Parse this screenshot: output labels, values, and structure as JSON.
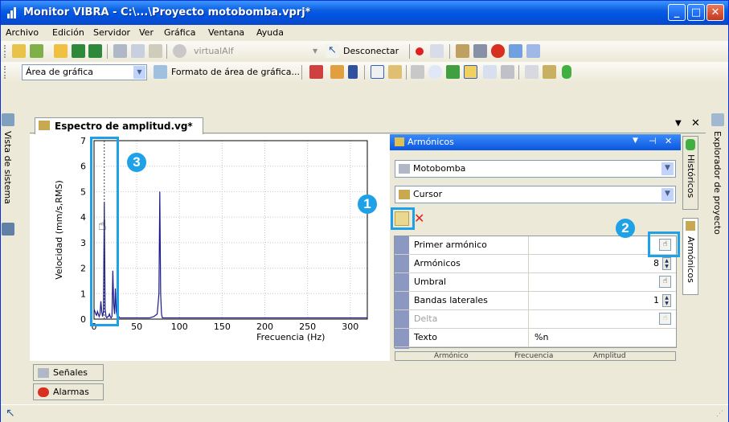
{
  "window": {
    "title": "Monitor VIBRA - C:\\...\\Proyecto motobomba.vprj*"
  },
  "menu": [
    "Archivo",
    "Edición",
    "Servidor",
    "Ver",
    "Gráfica",
    "Ventana",
    "Ayuda"
  ],
  "toolbar1": {
    "server_value": "virtualAlf",
    "disconnect_label": "Desconectar"
  },
  "toolbar2": {
    "area_value": "Área de gráfica",
    "format_label": "Formato de área de gráfica..."
  },
  "left_sidebar": {
    "tab": "Vista de sistema"
  },
  "right_sidebar": {
    "tab": "Explorador de proyecto"
  },
  "document": {
    "tab_label": "Espectro de amplitud.vg*"
  },
  "chart_data": {
    "type": "line",
    "xlabel": "Frecuencia (Hz)",
    "ylabel": "Velocidad (mm/s,RMS)",
    "xlim": [
      0,
      320
    ],
    "ylim": [
      0,
      7
    ],
    "xticks": [
      "0",
      "50",
      "100",
      "150",
      "200",
      "250",
      "300"
    ],
    "yticks": [
      "0",
      "1",
      "2",
      "3",
      "4",
      "5",
      "6",
      "7"
    ],
    "x": [
      0,
      1,
      2,
      3,
      4,
      5,
      6,
      7,
      8,
      9,
      10,
      11,
      12,
      13,
      14,
      15,
      16,
      17,
      18,
      19,
      20,
      21,
      22,
      23,
      24,
      25,
      26,
      27,
      28,
      29,
      30,
      32,
      35,
      40,
      45,
      50,
      55,
      60,
      65,
      70,
      74,
      76,
      77,
      78,
      79,
      80,
      82,
      85,
      90,
      100,
      120,
      150,
      200,
      250,
      300,
      320
    ],
    "y": [
      0.4,
      0.3,
      0.2,
      0.15,
      0.3,
      0.2,
      0.1,
      0.2,
      0.7,
      0.3,
      0.1,
      0.3,
      4.6,
      0.4,
      0.1,
      0.05,
      0.1,
      0.1,
      0.2,
      0.1,
      0.05,
      0.1,
      1.9,
      0.6,
      0.2,
      1.2,
      0.3,
      0.1,
      0.05,
      0.1,
      0.05,
      0.05,
      0.05,
      0.05,
      0.05,
      0.05,
      0.05,
      0.05,
      0.05,
      0.1,
      0.2,
      1.0,
      5.0,
      1.0,
      0.2,
      0.05,
      0.05,
      0.05,
      0.05,
      0.05,
      0.05,
      0.05,
      0.05,
      0.05,
      0.05,
      0.05
    ],
    "cursor_x": 12
  },
  "armonicos_panel": {
    "title": "Armónicos",
    "signal_value": "Motobomba",
    "mode_value": "Cursor",
    "side_tabs": [
      "Históricos",
      "Armónicos"
    ],
    "properties": [
      {
        "label": "Primer armónico",
        "value": ""
      },
      {
        "label": "Armónicos",
        "value": "8"
      },
      {
        "label": "Umbral",
        "value": ""
      },
      {
        "label": "Bandas laterales",
        "value": "1"
      },
      {
        "label": "Delta",
        "value": ""
      },
      {
        "label": "Texto",
        "value": "%n"
      }
    ],
    "table_headers": [
      "Armónico",
      "Frecuencia",
      "Amplitud"
    ]
  },
  "bottom_tabs": [
    "Señales",
    "Alarmas"
  ],
  "callouts": [
    "1",
    "2",
    "3"
  ]
}
